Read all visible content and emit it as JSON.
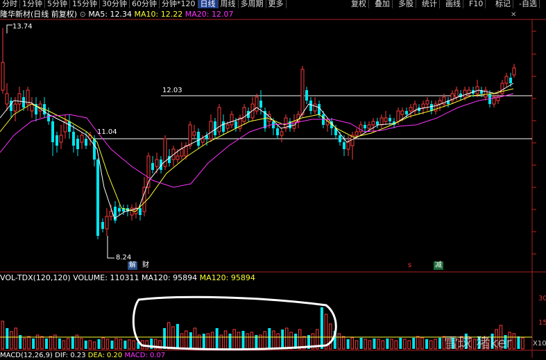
{
  "toolbar": {
    "periods": [
      "分时",
      "1分钟",
      "5分钟",
      "15分钟",
      "30分钟",
      "60分钟",
      "分钟*120",
      "日线",
      "周线",
      "多周期",
      "更多"
    ],
    "active_index": 7,
    "right_buttons": [
      "复权",
      "叠加",
      "多股",
      "统计",
      "画线",
      "F10",
      "标记",
      "-自选"
    ]
  },
  "stock": {
    "name": "隆华新材(日线 前复权)",
    "ma5": "MA5: 12.34",
    "ma10": "MA10: 12.22",
    "ma20": "MA20: 12.07"
  },
  "price_labels": {
    "high": "13.74",
    "low": "8.24",
    "line1": "12.03",
    "line2": "11.04"
  },
  "markers": {
    "jie": "解",
    "cai": "财",
    "s": "s",
    "jian": "减"
  },
  "volume": {
    "title": "VOL-TDX(120,120)",
    "volume": "VOLUME: 110311",
    "ma120a": "MA120: 95894",
    "ma120b": "MA120: 95894",
    "axis": [
      "30",
      "15"
    ],
    "unit": "X10"
  },
  "macd": {
    "title": "MACD(12,26,9)",
    "dif": "DIF: 0.23",
    "dea": "DEA: 0.20",
    "macd": "MACD: 0.07"
  },
  "watermark": "雪球 猪ker",
  "colors": {
    "up": "#ff3b3b",
    "down": "#00e5ee",
    "ma5": "#ffffff",
    "ma10": "#ffff33",
    "ma20": "#ff33ff",
    "axis": "#cc2222"
  }
}
